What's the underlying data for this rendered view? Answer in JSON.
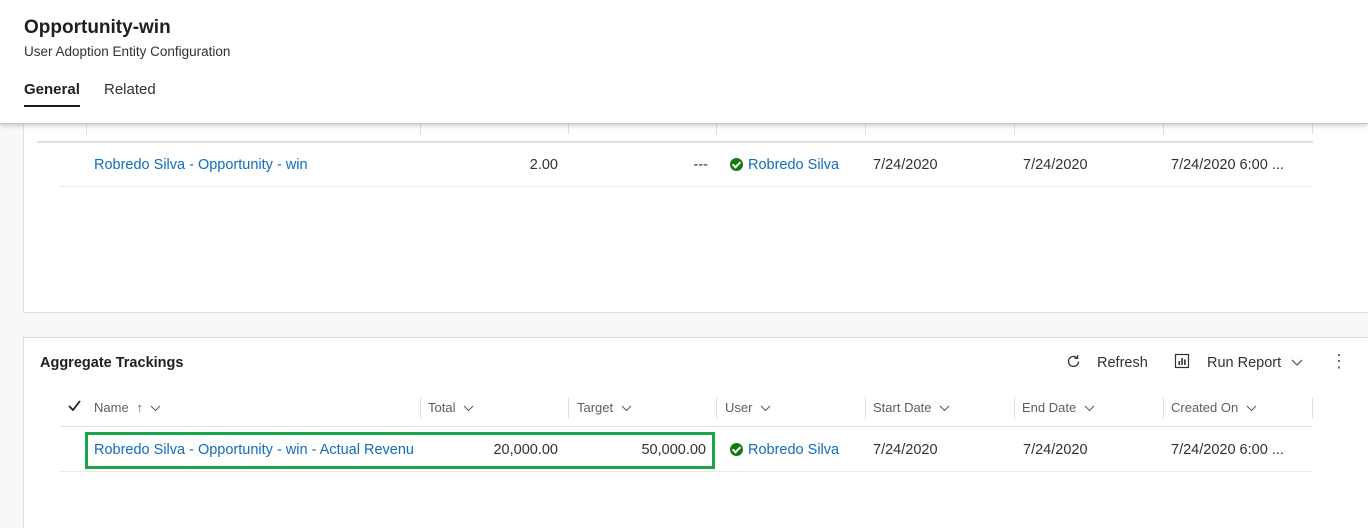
{
  "header": {
    "title": "Opportunity-win",
    "subtitle": "User Adoption Entity Configuration",
    "tabs": [
      {
        "label": "General",
        "selected": true
      },
      {
        "label": "Related",
        "selected": false
      }
    ]
  },
  "top_grid": {
    "row": {
      "name": "Robredo Silva - Opportunity - win",
      "total": "2.00",
      "target": "---",
      "user": "Robredo Silva",
      "start_date": "7/24/2020",
      "end_date": "7/24/2020",
      "created_on": "7/24/2020 6:00 ..."
    }
  },
  "aggregate": {
    "title": "Aggregate Trackings",
    "commands": {
      "refresh": "Refresh",
      "run_report": "Run Report",
      "refresh_icon": "refresh-icon",
      "report_icon": "report-icon",
      "more": "⋮"
    },
    "columns": {
      "name": "Name",
      "sort_icon": "↑",
      "total": "Total",
      "target": "Target",
      "user": "User",
      "start_date": "Start Date",
      "end_date": "End Date",
      "created_on": "Created On"
    },
    "row": {
      "name": "Robredo Silva - Opportunity - win - Actual Revenu",
      "total": "20,000.00",
      "target": "50,000.00",
      "user": "Robredo Silva",
      "start_date": "7/24/2020",
      "end_date": "7/24/2020",
      "created_on": "7/24/2020 6:00 ..."
    },
    "highlight_color": "#19a64b"
  },
  "colors": {
    "link": "#106ebe",
    "status_ok": "#107c10"
  }
}
